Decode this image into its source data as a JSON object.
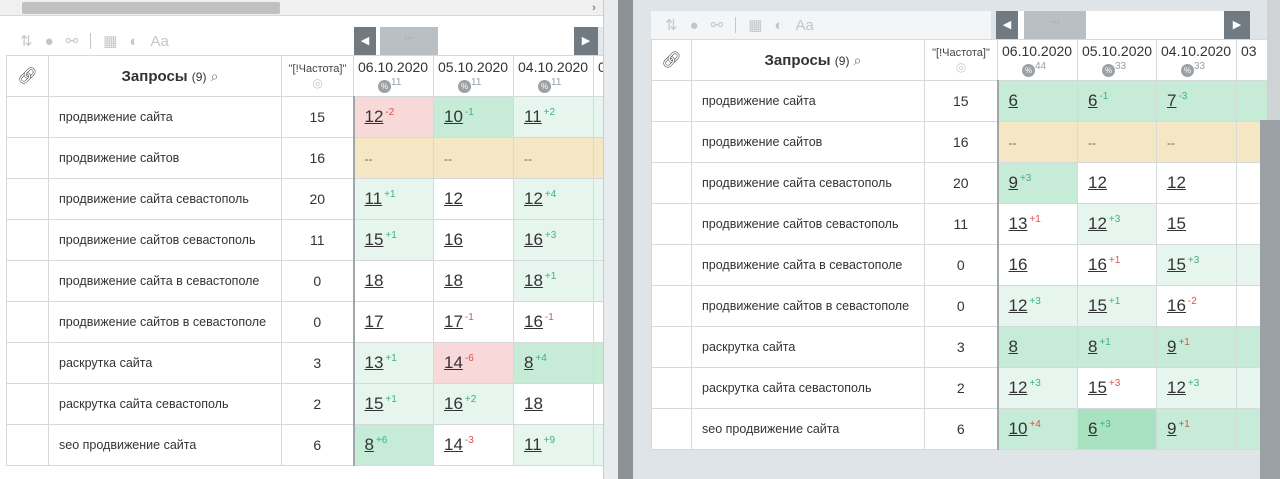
{
  "ui": {
    "link_icon": "link-icon",
    "search_icon": "magnifier-icon",
    "globe_icon": "globe-icon",
    "percent_icon": "percent-icon",
    "nav_prev": "◀",
    "nav_next": "▶",
    "nav_thumb": "⋯",
    "scroll_left": "‹",
    "scroll_right": "›"
  },
  "toolbar": {
    "sort": "⇅",
    "toggle": "●",
    "link": "⚯",
    "grid": "▦",
    "contrast": "◐",
    "font": "Aa"
  },
  "left": {
    "title": "Запросы",
    "count": "(9)",
    "freq_label": "\"[!Частота]\"",
    "dates": [
      {
        "label": "06.10.2020",
        "sub": "11"
      },
      {
        "label": "05.10.2020",
        "sub": "11"
      },
      {
        "label": "04.10.2020",
        "sub": "11"
      },
      {
        "label": "0",
        "sub": ""
      }
    ],
    "rows": [
      {
        "q": "продвижение сайта",
        "f": "15",
        "cells": [
          {
            "v": "12",
            "d": "-2",
            "dir": "down",
            "bg": "bg-red"
          },
          {
            "v": "10",
            "d": "-1",
            "dir": "up",
            "bg": "bg-green"
          },
          {
            "v": "11",
            "d": "+2",
            "dir": "up",
            "bg": "bg-lgreen"
          }
        ]
      },
      {
        "q": "продвижение сайтов",
        "f": "16",
        "cells": [
          {
            "v": "--",
            "d": "",
            "dir": "",
            "bg": "bg-yellow"
          },
          {
            "v": "--",
            "d": "",
            "dir": "",
            "bg": "bg-yellow"
          },
          {
            "v": "--",
            "d": "",
            "dir": "",
            "bg": "bg-yellow"
          }
        ]
      },
      {
        "q": "продвижение сайта севастополь",
        "f": "20",
        "cells": [
          {
            "v": "11",
            "d": "+1",
            "dir": "up",
            "bg": "bg-lgreen"
          },
          {
            "v": "12",
            "d": "",
            "dir": "",
            "bg": "bg-white"
          },
          {
            "v": "12",
            "d": "+4",
            "dir": "up",
            "bg": "bg-lgreen"
          }
        ]
      },
      {
        "q": "продвижение сайтов севастополь",
        "f": "11",
        "cells": [
          {
            "v": "15",
            "d": "+1",
            "dir": "up",
            "bg": "bg-lgreen"
          },
          {
            "v": "16",
            "d": "",
            "dir": "",
            "bg": "bg-white"
          },
          {
            "v": "16",
            "d": "+3",
            "dir": "up",
            "bg": "bg-lgreen"
          }
        ]
      },
      {
        "q": "продвижение сайта в севастополе",
        "f": "0",
        "cells": [
          {
            "v": "18",
            "d": "",
            "dir": "",
            "bg": "bg-white"
          },
          {
            "v": "18",
            "d": "",
            "dir": "",
            "bg": "bg-white"
          },
          {
            "v": "18",
            "d": "+1",
            "dir": "up",
            "bg": "bg-lgreen"
          }
        ]
      },
      {
        "q": "продвижение сайтов в севастополе",
        "f": "0",
        "cells": [
          {
            "v": "17",
            "d": "",
            "dir": "",
            "bg": "bg-white"
          },
          {
            "v": "17",
            "d": "-1",
            "dir": "down",
            "bg": "bg-white"
          },
          {
            "v": "16",
            "d": "-1",
            "dir": "down",
            "bg": "bg-white"
          }
        ]
      },
      {
        "q": "раскрутка сайта",
        "f": "3",
        "cells": [
          {
            "v": "13",
            "d": "+1",
            "dir": "up",
            "bg": "bg-lgreen"
          },
          {
            "v": "14",
            "d": "-6",
            "dir": "down",
            "bg": "bg-red"
          },
          {
            "v": "8",
            "d": "+4",
            "dir": "up",
            "bg": "bg-green"
          }
        ]
      },
      {
        "q": "раскрутка сайта севастополь",
        "f": "2",
        "cells": [
          {
            "v": "15",
            "d": "+1",
            "dir": "up",
            "bg": "bg-lgreen"
          },
          {
            "v": "16",
            "d": "+2",
            "dir": "up",
            "bg": "bg-lgreen"
          },
          {
            "v": "18",
            "d": "",
            "dir": "",
            "bg": "bg-white"
          }
        ]
      },
      {
        "q": "seo продвижение сайта",
        "f": "6",
        "cells": [
          {
            "v": "8",
            "d": "+6",
            "dir": "up",
            "bg": "bg-green"
          },
          {
            "v": "14",
            "d": "-3",
            "dir": "down",
            "bg": "bg-white"
          },
          {
            "v": "11",
            "d": "+9",
            "dir": "up",
            "bg": "bg-lgreen"
          }
        ]
      }
    ]
  },
  "right": {
    "title": "Запросы",
    "count": "(9)",
    "freq_label": "\"[!Частота]\"",
    "dates": [
      {
        "label": "06.10.2020",
        "sub": "44"
      },
      {
        "label": "05.10.2020",
        "sub": "33"
      },
      {
        "label": "04.10.2020",
        "sub": "33"
      },
      {
        "label": "03",
        "sub": ""
      }
    ],
    "rows": [
      {
        "q": "продвижение сайта",
        "f": "15",
        "cells": [
          {
            "v": "6",
            "d": "",
            "dir": "",
            "bg": "bg-green"
          },
          {
            "v": "6",
            "d": "-1",
            "dir": "up",
            "bg": "bg-green"
          },
          {
            "v": "7",
            "d": "-3",
            "dir": "up",
            "bg": "bg-green"
          }
        ]
      },
      {
        "q": "продвижение сайтов",
        "f": "16",
        "cells": [
          {
            "v": "--",
            "d": "",
            "dir": "",
            "bg": "bg-yellow"
          },
          {
            "v": "--",
            "d": "",
            "dir": "",
            "bg": "bg-yellow"
          },
          {
            "v": "--",
            "d": "",
            "dir": "",
            "bg": "bg-yellow"
          }
        ]
      },
      {
        "q": "продвижение сайта севастополь",
        "f": "20",
        "cells": [
          {
            "v": "9",
            "d": "+3",
            "dir": "up",
            "bg": "bg-green"
          },
          {
            "v": "12",
            "d": "",
            "dir": "",
            "bg": "bg-white"
          },
          {
            "v": "12",
            "d": "",
            "dir": "",
            "bg": "bg-white"
          }
        ]
      },
      {
        "q": "продвижение сайтов севастополь",
        "f": "11",
        "cells": [
          {
            "v": "13",
            "d": "+1",
            "dir": "down",
            "bg": "bg-white"
          },
          {
            "v": "12",
            "d": "+3",
            "dir": "up",
            "bg": "bg-lgreen"
          },
          {
            "v": "15",
            "d": "",
            "dir": "",
            "bg": "bg-white"
          }
        ]
      },
      {
        "q": "продвижение сайта в севастополе",
        "f": "0",
        "cells": [
          {
            "v": "16",
            "d": "",
            "dir": "",
            "bg": "bg-white"
          },
          {
            "v": "16",
            "d": "+1",
            "dir": "down",
            "bg": "bg-white"
          },
          {
            "v": "15",
            "d": "+3",
            "dir": "up",
            "bg": "bg-lgreen"
          }
        ]
      },
      {
        "q": "продвижение сайтов в севастополе",
        "f": "0",
        "cells": [
          {
            "v": "12",
            "d": "+3",
            "dir": "up",
            "bg": "bg-lgreen"
          },
          {
            "v": "15",
            "d": "+1",
            "dir": "up",
            "bg": "bg-lgreen"
          },
          {
            "v": "16",
            "d": "-2",
            "dir": "down",
            "bg": "bg-white"
          }
        ]
      },
      {
        "q": "раскрутка сайта",
        "f": "3",
        "cells": [
          {
            "v": "8",
            "d": "",
            "dir": "",
            "bg": "bg-green"
          },
          {
            "v": "8",
            "d": "+1",
            "dir": "up",
            "bg": "bg-green"
          },
          {
            "v": "9",
            "d": "+1",
            "dir": "down",
            "bg": "bg-green"
          }
        ]
      },
      {
        "q": "раскрутка сайта севастополь",
        "f": "2",
        "cells": [
          {
            "v": "12",
            "d": "+3",
            "dir": "up",
            "bg": "bg-lgreen"
          },
          {
            "v": "15",
            "d": "+3",
            "dir": "down",
            "bg": "bg-white"
          },
          {
            "v": "12",
            "d": "+3",
            "dir": "up",
            "bg": "bg-lgreen"
          }
        ]
      },
      {
        "q": "seo продвижение сайта",
        "f": "6",
        "cells": [
          {
            "v": "10",
            "d": "+4",
            "dir": "down",
            "bg": "bg-green"
          },
          {
            "v": "6",
            "d": "+3",
            "dir": "up",
            "bg": "bg-dgreen"
          },
          {
            "v": "9",
            "d": "+1",
            "dir": "down",
            "bg": "bg-green"
          }
        ]
      }
    ]
  }
}
